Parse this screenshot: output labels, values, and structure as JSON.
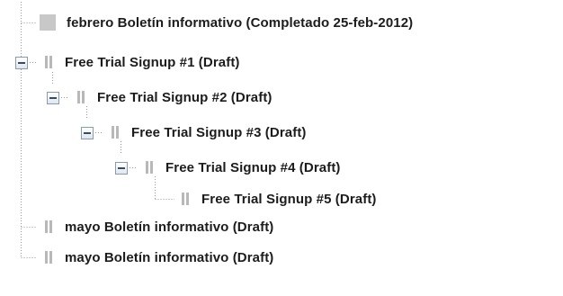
{
  "tree": {
    "items": [
      {
        "label": "febrero Boletín informativo (Completado 25-feb-2012)",
        "status": "completed",
        "expand_state": "none"
      },
      {
        "label": "Free Trial Signup #1 (Draft)",
        "status": "draft",
        "expand_state": "expanded"
      },
      {
        "label": "Free Trial Signup #2 (Draft)",
        "status": "draft",
        "expand_state": "expanded"
      },
      {
        "label": "Free Trial Signup #3 (Draft)",
        "status": "draft",
        "expand_state": "expanded"
      },
      {
        "label": "Free Trial Signup #4 (Draft)",
        "status": "draft",
        "expand_state": "expanded"
      },
      {
        "label": "Free Trial Signup #5 (Draft)",
        "status": "draft",
        "expand_state": "none"
      },
      {
        "label": "mayo Boletín informativo (Draft)",
        "status": "draft",
        "expand_state": "none"
      },
      {
        "label": "mayo Boletín informativo (Draft)",
        "status": "draft",
        "expand_state": "none"
      }
    ]
  },
  "colors": {
    "completed_icon": "#c8c8c8",
    "draft_icon": "#b8b8b8",
    "connector_line": "#9a9a9a",
    "text": "#1c1c1c"
  },
  "icons": {
    "completed": "completed-status-icon",
    "draft": "draft-status-icon",
    "collapse": "collapse-minus-icon"
  }
}
